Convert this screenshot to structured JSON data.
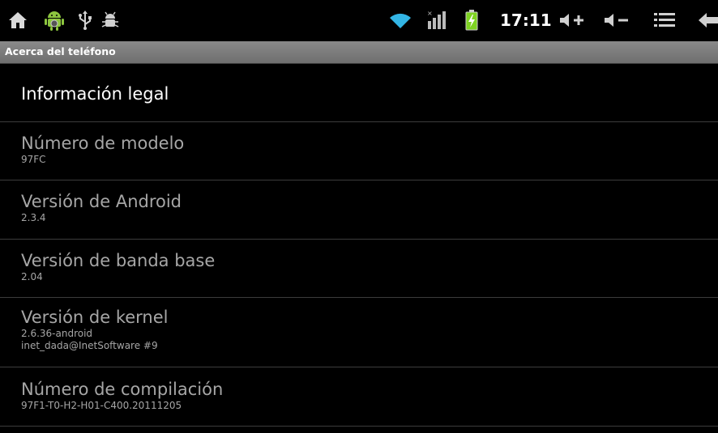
{
  "status_bar": {
    "time": "17:11",
    "left_icons": [
      "home-icon",
      "android-icon",
      "usb-icon",
      "debug-icon"
    ],
    "right_icons": [
      "wifi-icon",
      "signal-icon",
      "battery-charging-icon",
      "volume-up-icon",
      "volume-down-icon",
      "menu-icon",
      "back-icon"
    ],
    "accent_color": "#33b5e5",
    "android_color": "#8dc63f",
    "battery_color": "#7ed321"
  },
  "header": {
    "title": "Acerca del teléfono"
  },
  "items": [
    {
      "title": "Información legal",
      "lines": []
    },
    {
      "title": "Número de modelo",
      "lines": [
        "97FC"
      ]
    },
    {
      "title": "Versión de Android",
      "lines": [
        "2.3.4"
      ]
    },
    {
      "title": "Versión de banda base",
      "lines": [
        "2.04"
      ]
    },
    {
      "title": "Versión de kernel",
      "lines": [
        "2.6.36-android",
        "inet_dada@InetSoftware #9"
      ]
    },
    {
      "title": "Número de compilación",
      "lines": [
        "97F1-T0-H2-H01-C400.20111205"
      ]
    }
  ]
}
